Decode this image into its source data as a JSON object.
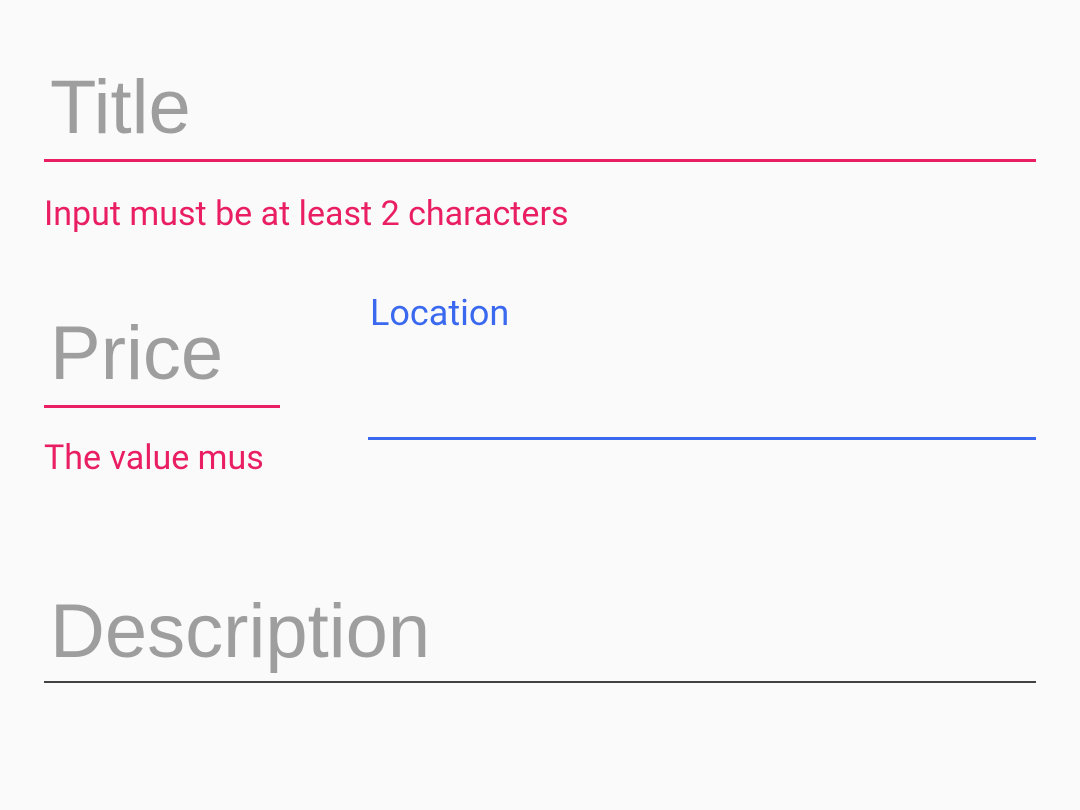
{
  "fields": {
    "title": {
      "placeholder": "Title",
      "value": "",
      "error": "Input must be at least 2 characters"
    },
    "price": {
      "placeholder": "Price",
      "value": "",
      "error": "The value mus"
    },
    "location": {
      "label": "Location",
      "value": ""
    },
    "description": {
      "placeholder": "Description",
      "value": ""
    }
  },
  "colors": {
    "error": "#e91e63",
    "focus": "#3a69ef",
    "idle_underline": "#424242",
    "placeholder": "#9e9e9e",
    "background": "#fafafa"
  }
}
